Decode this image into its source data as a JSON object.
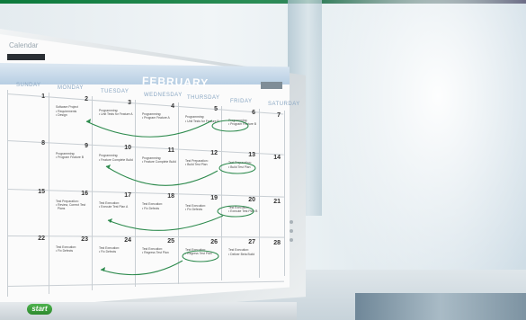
{
  "window": {
    "title": "Calendar",
    "month": "FEBRUARY"
  },
  "weekdays": [
    "SUNDAY",
    "MONDAY",
    "TUESDAY",
    "WEDNESDAY",
    "THURSDAY",
    "FRIDAY",
    "SATURDAY"
  ],
  "taskbar": {
    "start_label": "start"
  },
  "weeks": [
    {
      "days": [
        {
          "num": "1",
          "task": ""
        },
        {
          "num": "2",
          "task": "Software Project\n• Requirements\n• Design"
        },
        {
          "num": "3",
          "task": "Programming:\n• Unit Tests for Feature A"
        },
        {
          "num": "4",
          "task": "Programming:\n• Program Feature A"
        },
        {
          "num": "5",
          "task": "Programming:\n• Unit Tests for Feature B"
        },
        {
          "num": "6",
          "task": "Programming:\n• Program Feature B"
        },
        {
          "num": "7",
          "task": ""
        }
      ]
    },
    {
      "days": [
        {
          "num": "8",
          "task": ""
        },
        {
          "num": "9",
          "task": "Programming:\n• Program Feature B"
        },
        {
          "num": "10",
          "task": "Programming:\n• Feature Complete Build"
        },
        {
          "num": "11",
          "task": "Programming:\n• Feature Complete Build"
        },
        {
          "num": "12",
          "task": "Test Preparation:\n• Build Test Plan"
        },
        {
          "num": "13",
          "task": "Test Preparation:\n• Build Test Plan"
        },
        {
          "num": "14",
          "task": ""
        }
      ]
    },
    {
      "days": [
        {
          "num": "15",
          "task": ""
        },
        {
          "num": "16",
          "task": "Test Preparation:\n• Review, Correct Test\n  Plans"
        },
        {
          "num": "17",
          "task": "Test Execution:\n• Execute Test Plan A"
        },
        {
          "num": "18",
          "task": "Test Execution:\n• Fix Defects"
        },
        {
          "num": "19",
          "task": "Test Execution:\n• Fix Defects"
        },
        {
          "num": "20",
          "task": "Test Execution:\n• Execute Test Plan B"
        },
        {
          "num": "21",
          "task": ""
        }
      ]
    },
    {
      "days": [
        {
          "num": "22",
          "task": ""
        },
        {
          "num": "23",
          "task": "Test Execution:\n• Fix Defects"
        },
        {
          "num": "24",
          "task": "Test Execution:\n• Fix Defects"
        },
        {
          "num": "25",
          "task": "Test Execution:\n• Regress Test Plan"
        },
        {
          "num": "26",
          "task": "Test Execution:\n• Regress Test Plan"
        },
        {
          "num": "27",
          "task": "Test Execution:\n• Deliver Beta Build"
        },
        {
          "num": "28",
          "task": ""
        }
      ]
    }
  ]
}
